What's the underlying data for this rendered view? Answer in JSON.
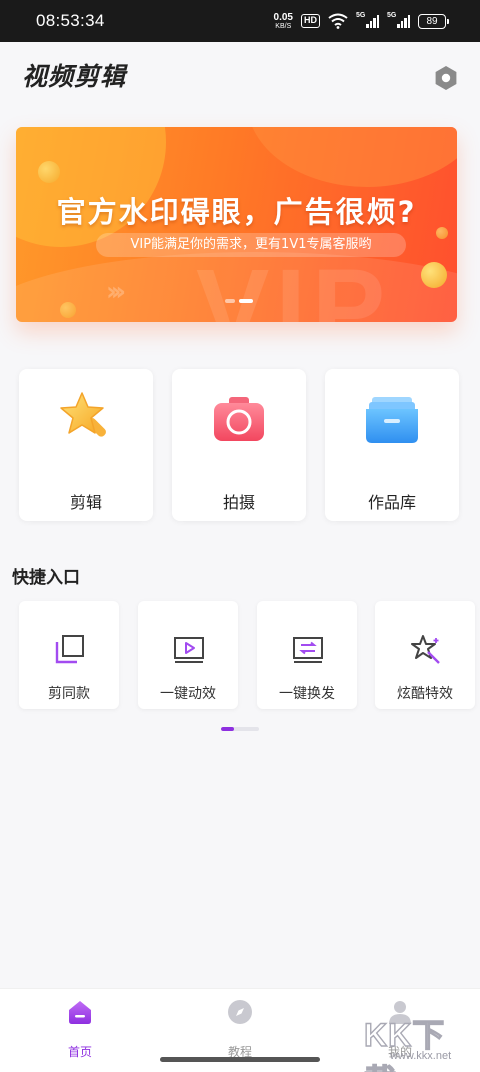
{
  "status_bar": {
    "time": "08:53:34",
    "net_speed_value": "0.05",
    "net_speed_unit": "KB/S",
    "hd_label": "HD",
    "signal1_label": "5G",
    "signal2_label": "5G",
    "battery": "89"
  },
  "header": {
    "logo": "视频剪辑",
    "settings_icon": "hexagon-settings-icon"
  },
  "banner": {
    "title": "官方水印碍眼，广告很烦?",
    "subtitle": "VIP能满足你的需求，更有1V1专属客服哟",
    "watermark_text": "VIP",
    "slides": 2,
    "active_slide": 2,
    "colors": {
      "start": "#ff9a2a",
      "end": "#ff4f2e"
    }
  },
  "main_tiles": [
    {
      "label": "剪辑",
      "icon": "star-wand-icon"
    },
    {
      "label": "拍摄",
      "icon": "camera-icon"
    },
    {
      "label": "作品库",
      "icon": "folder-icon"
    }
  ],
  "quick_entry": {
    "title": "快捷入口",
    "items": [
      {
        "label": "剪同款",
        "icon": "copy-squares-icon"
      },
      {
        "label": "一键动效",
        "icon": "play-frame-icon"
      },
      {
        "label": "一键换发",
        "icon": "swap-frame-icon"
      },
      {
        "label": "炫酷特效",
        "icon": "sparkle-star-icon"
      }
    ],
    "page_progress": 0.33
  },
  "bottom_nav": {
    "items": [
      {
        "label": "首页",
        "icon": "home-icon",
        "active": true
      },
      {
        "label": "教程",
        "icon": "compass-icon",
        "active": false
      },
      {
        "label": "我的",
        "icon": "profile-icon",
        "active": false
      }
    ]
  },
  "colors": {
    "accent": "#8e2fe0",
    "background": "#f7f7f9"
  },
  "watermark": {
    "text": "KK下载",
    "url": "www.kkx.net"
  }
}
